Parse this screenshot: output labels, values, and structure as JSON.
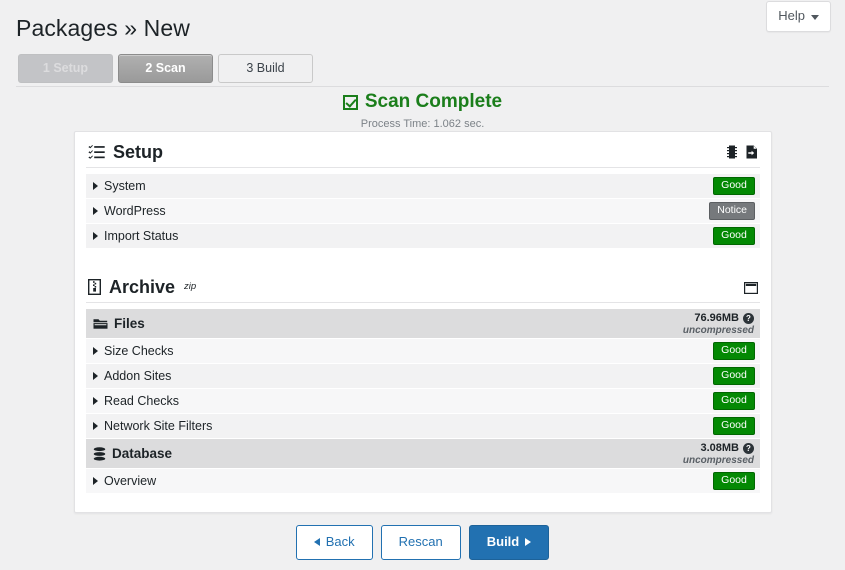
{
  "header": {
    "title": "Packages » New",
    "help_label": "Help"
  },
  "steps": [
    {
      "label": "1 Setup",
      "state": "done"
    },
    {
      "label": "2 Scan",
      "state": "active"
    },
    {
      "label": "3 Build",
      "state": "pending"
    }
  ],
  "status": {
    "title": "Scan Complete",
    "subtitle": "Process Time: 1.062 sec.",
    "icon": "checkbox-checked-icon",
    "color": "#1b7e1b"
  },
  "setup_section": {
    "title": "Setup",
    "icon": "tasks-list-icon",
    "header_icons": [
      {
        "name": "server-chip-icon"
      },
      {
        "name": "file-export-icon"
      }
    ],
    "rows": [
      {
        "label": "System",
        "badge": "Good",
        "badge_kind": "good"
      },
      {
        "label": "WordPress",
        "badge": "Notice",
        "badge_kind": "notice"
      },
      {
        "label": "Import Status",
        "badge": "Good",
        "badge_kind": "good"
      }
    ]
  },
  "archive_section": {
    "title": "Archive",
    "superscript": "zip",
    "icon": "archive-file-icon",
    "header_icons": [
      {
        "name": "window-panel-icon"
      }
    ],
    "groups": [
      {
        "label": "Files",
        "icon": "folder-open-icon",
        "size": "76.96MB",
        "size_note": "uncompressed",
        "rows": [
          {
            "label": "Size Checks",
            "badge": "Good",
            "badge_kind": "good"
          },
          {
            "label": "Addon Sites",
            "badge": "Good",
            "badge_kind": "good"
          },
          {
            "label": "Read Checks",
            "badge": "Good",
            "badge_kind": "good"
          },
          {
            "label": "Network Site Filters",
            "badge": "Good",
            "badge_kind": "good"
          }
        ]
      },
      {
        "label": "Database",
        "icon": "database-icon",
        "size": "3.08MB",
        "size_note": "uncompressed",
        "rows": [
          {
            "label": "Overview",
            "badge": "Good",
            "badge_kind": "good"
          }
        ]
      }
    ]
  },
  "footer": {
    "back_label": "Back",
    "rescan_label": "Rescan",
    "build_label": "Build",
    "primary_color": "#2271b1"
  },
  "colors": {
    "page_background": "#f0f0f1",
    "good": "#038903",
    "notice": "#76797c",
    "success_text": "#1b7e1b"
  }
}
